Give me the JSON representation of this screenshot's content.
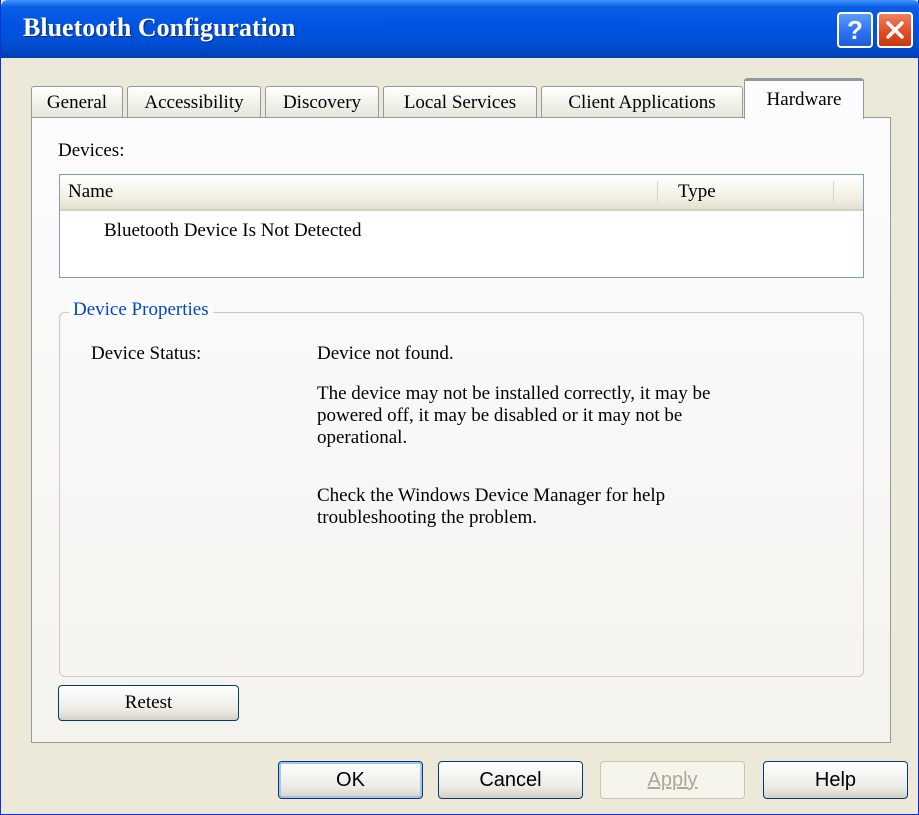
{
  "window": {
    "title": "Bluetooth Configuration",
    "help_icon": "help-question-icon",
    "close_icon": "close-x-icon"
  },
  "tabs": [
    {
      "label": "General",
      "active": false
    },
    {
      "label": "Accessibility",
      "active": false
    },
    {
      "label": "Discovery",
      "active": false
    },
    {
      "label": "Local Services",
      "active": false
    },
    {
      "label": "Client Applications",
      "active": false
    },
    {
      "label": "Hardware",
      "active": true
    }
  ],
  "hardware": {
    "devices_label": "Devices:",
    "columns": [
      "Name",
      "Type"
    ],
    "rows": [
      {
        "name": "Bluetooth Device Is Not Detected",
        "type": ""
      }
    ],
    "properties": {
      "title": "Device Properties",
      "status_label": "Device Status:",
      "status_value": "Device not found.",
      "message_lines": [
        "The device may not be installed correctly, it may be",
        "powered off, it may be disabled or it may not be",
        "operational."
      ],
      "help_lines": [
        "Check the Windows Device Manager for help",
        "troubleshooting the problem."
      ]
    },
    "retest_label": "Retest"
  },
  "footer": {
    "ok_label": "OK",
    "cancel_label": "Cancel",
    "apply_label": "Apply",
    "apply_enabled": false,
    "help_label": "Help"
  },
  "colors": {
    "titlebar": "#0054e3",
    "group_title": "#0046d5",
    "active_tab_accent": "#ffc83c",
    "close_button": "#e04a22"
  }
}
